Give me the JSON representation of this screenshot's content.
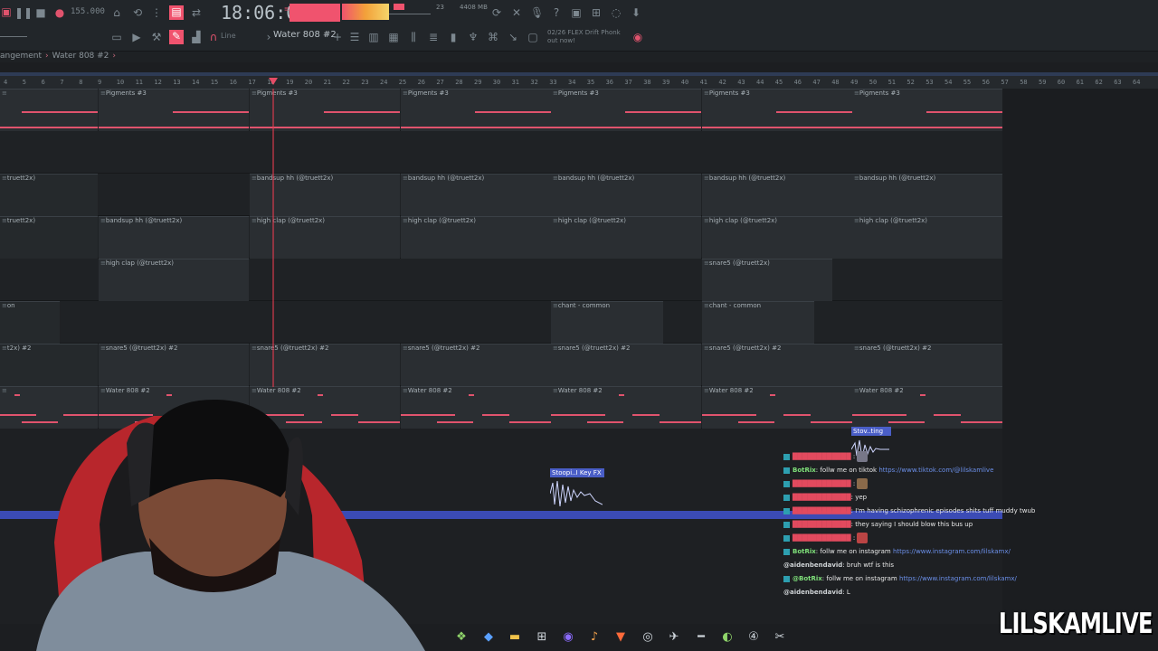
{
  "toolbar": {
    "tempo": "155.000",
    "clock": "18:06:09",
    "cpu": "23",
    "memory": "4408 MB",
    "snap_label": "Line",
    "pattern": "Water 808 #2",
    "plugin_line1": "02/26 FLEX Drift Phonk",
    "plugin_line2": "out now!"
  },
  "breadcrumb": {
    "part1": "angement",
    "part2": "Water 808 #2"
  },
  "ruler": {
    "ticks": [
      "4",
      "5",
      "6",
      "7",
      "8",
      "9",
      "10",
      "11",
      "12",
      "13",
      "14",
      "15",
      "16",
      "17",
      "18",
      "19",
      "20",
      "21",
      "22",
      "23",
      "24",
      "25",
      "26",
      "27",
      "28",
      "29",
      "30",
      "31",
      "32",
      "33",
      "34",
      "35",
      "36",
      "37",
      "38",
      "39",
      "40",
      "41",
      "42",
      "43",
      "44",
      "45",
      "46",
      "47",
      "48",
      "49",
      "50",
      "51",
      "52",
      "53",
      "54",
      "55",
      "56",
      "57",
      "58",
      "59",
      "60",
      "61",
      "62",
      "63",
      "64"
    ]
  },
  "clips": {
    "pigments": "Pigments #3",
    "bandsup": "bandsup hh (@truett2x)",
    "bandsup_cut": "truett2x)",
    "high_clap": "high clap (@truett2x)",
    "high_clap_cut": "truett2x)",
    "snare5": "snare5 (@truett2x)",
    "snare5_2": "snare5 (@truett2x) #2",
    "snare5_2_cut": "t2x) #2",
    "chant": "chant - common",
    "chant_cut": "on",
    "water": "Water 808 #2",
    "stov": "Stov..ting",
    "stoopi": "Stoopi..I Key FX"
  },
  "chat": {
    "lines": [
      {
        "user": "BotRix",
        "text": ": follw me on tiktok ",
        "link": "https://www.tiktok.com/@lilskamlive"
      },
      {
        "user": "",
        "text": ": yep",
        "link": ""
      },
      {
        "user": "",
        "text": ": I'm having schizophrenic episodes shits tuff muddy twub",
        "link": ""
      },
      {
        "user": "",
        "text": ": they saying I should blow this bus up",
        "link": ""
      },
      {
        "user": "BotRix",
        "text": ": follw me on instagram ",
        "link": "https://www.instagram.com/lilskamx/"
      },
      {
        "user": "@aidenbendavid",
        "text": ": bruh wtf is this",
        "link": ""
      },
      {
        "user": "@BotRix",
        "text": ": follw me on instagram ",
        "link": "https://www.instagram.com/lilskamx/"
      },
      {
        "user": "@aidenbendavid",
        "text": ": L",
        "link": ""
      }
    ]
  },
  "watermark": "LILSKAMLIVE",
  "colors": {
    "accent": "#f0536e",
    "note": "#e0536d",
    "link": "#6b8fe8",
    "chat_user": "#7fe07a"
  }
}
